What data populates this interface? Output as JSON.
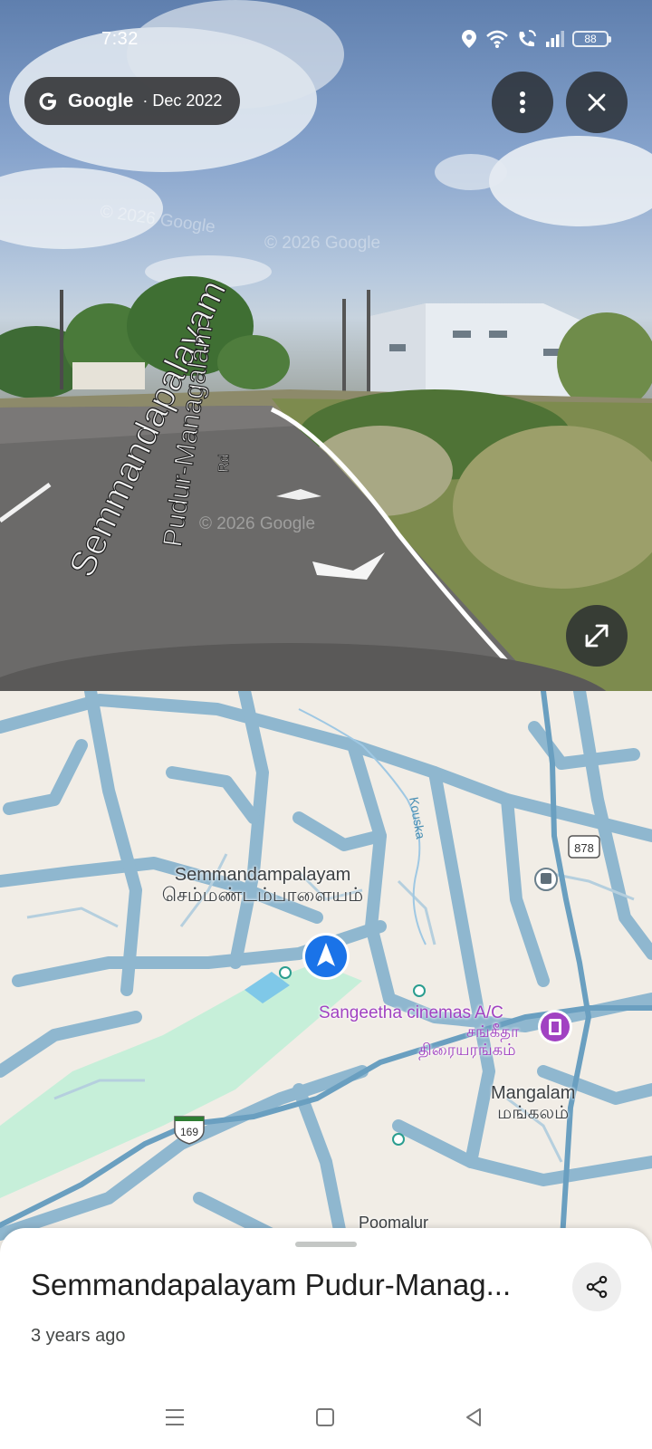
{
  "status_bar": {
    "time": "7:32",
    "battery_level": "88",
    "icons": [
      "location-icon",
      "wifi-icon",
      "wifi-call-icon",
      "signal-icon",
      "battery-icon"
    ]
  },
  "street_view": {
    "brand": "Google",
    "date": "· Dec 2022",
    "watermarks": [
      "© 2026 Google",
      "© 2026 Google",
      "© 2026 Google"
    ],
    "road_labels": [
      "Semmandapalayam",
      "Pudur-Managalam",
      "Rd"
    ],
    "buttons": {
      "menu": "more-vert-icon",
      "close": "close-icon",
      "expand": "expand-icon"
    }
  },
  "map": {
    "labels": [
      {
        "en": "Semmandampalayam",
        "ta": "செம்மண்டம்பாளையம்"
      },
      {
        "en": "Mangalam",
        "ta": "மங்கலம்"
      },
      {
        "en": "Poomalur"
      }
    ],
    "poi": {
      "en": "Sangeetha cinemas A/C",
      "ta_line1": "சங்கீதா",
      "ta_line2": "திரையரங்கம்"
    },
    "river": "Kouska",
    "route_shields": [
      "878",
      "169"
    ],
    "colors": {
      "roads": "#8fb7cf",
      "park": "#c6efd9",
      "land": "#f1ede6",
      "location_marker": "#1a73e8",
      "poi": "#a142c2"
    }
  },
  "sheet": {
    "title": "Semmandapalayam Pudur-Manag...",
    "subtitle": "3 years ago"
  }
}
